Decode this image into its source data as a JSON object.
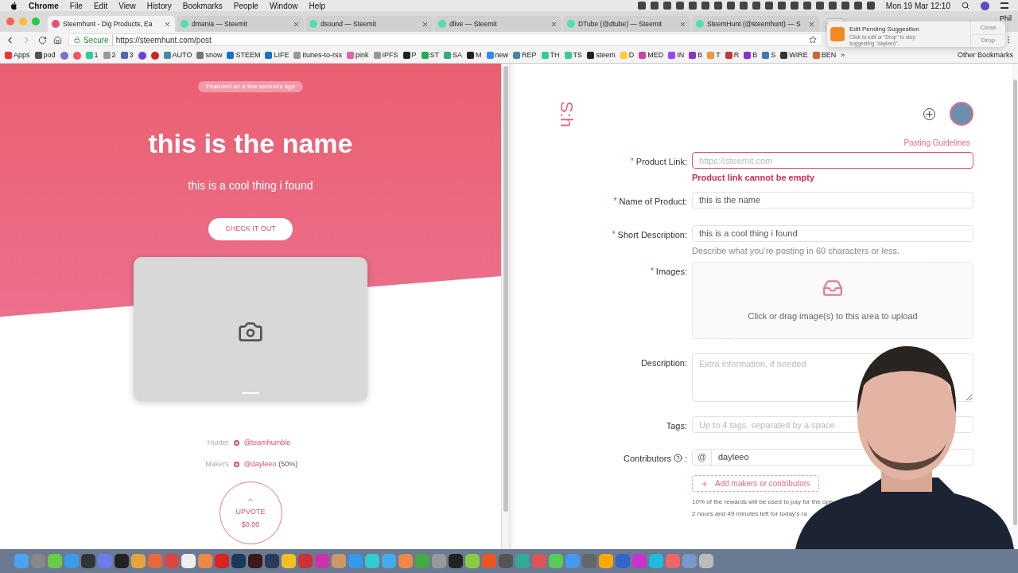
{
  "menu_bar": {
    "app": "Chrome",
    "items": [
      "File",
      "Edit",
      "View",
      "History",
      "Bookmarks",
      "People",
      "Window",
      "Help"
    ],
    "clock": "Mon 19 Mar 12:10"
  },
  "tabs": [
    {
      "title": "Steemhunt - Dig Products, Ea",
      "selected": true
    },
    {
      "title": "dmania — Steemit",
      "selected": false
    },
    {
      "title": "dsound — Steemit",
      "selected": false
    },
    {
      "title": "dlive — Steemit",
      "selected": false
    },
    {
      "title": "DTube (@dtube) — Steemit",
      "selected": false
    },
    {
      "title": "SteemHunt (@steemhunt) — S",
      "selected": false
    }
  ],
  "profile_name": "Phil",
  "address_bar": {
    "security": "Secure",
    "url": "https://steemhunt.com/post"
  },
  "bookmarks": [
    {
      "kind": "link",
      "label": "Apps"
    },
    {
      "kind": "link",
      "label": "pod"
    },
    {
      "kind": "icon"
    },
    {
      "kind": "icon"
    },
    {
      "kind": "link",
      "label": "1"
    },
    {
      "kind": "link",
      "label": "2"
    },
    {
      "kind": "link",
      "label": "3"
    },
    {
      "kind": "icon"
    },
    {
      "kind": "icon"
    },
    {
      "kind": "link",
      "label": "AUTO"
    },
    {
      "kind": "link",
      "label": "snow"
    },
    {
      "kind": "link",
      "label": "STEEM"
    },
    {
      "kind": "link",
      "label": "LIFE"
    },
    {
      "kind": "link",
      "label": "itunes-to-rss"
    },
    {
      "kind": "link",
      "label": "pink"
    },
    {
      "kind": "link",
      "label": "IPFS"
    },
    {
      "kind": "link",
      "label": "P"
    },
    {
      "kind": "link",
      "label": "ST"
    },
    {
      "kind": "link",
      "label": "SA"
    },
    {
      "kind": "link",
      "label": "M"
    },
    {
      "kind": "link",
      "label": "new"
    },
    {
      "kind": "link",
      "label": "REP"
    },
    {
      "kind": "link",
      "label": "TH"
    },
    {
      "kind": "link",
      "label": "TS"
    },
    {
      "kind": "link",
      "label": "steem"
    },
    {
      "kind": "link",
      "label": "D"
    },
    {
      "kind": "link",
      "label": "MED"
    },
    {
      "kind": "link",
      "label": "IN"
    },
    {
      "kind": "link",
      "label": "B"
    },
    {
      "kind": "link",
      "label": "T"
    },
    {
      "kind": "link",
      "label": "R"
    },
    {
      "kind": "link",
      "label": "B"
    },
    {
      "kind": "link",
      "label": "S"
    },
    {
      "kind": "link",
      "label": "WIRE"
    },
    {
      "kind": "link",
      "label": "BEN"
    }
  ],
  "bookmarks_more": "»",
  "other_bookmarks": "Other Bookmarks",
  "notification": {
    "title": "Edit Pending Suggestion",
    "body": "Click to edit or \"Drop\" to stop suggesting \"dayleeo\".",
    "buttons": [
      "Close",
      "Drop"
    ]
  },
  "preview": {
    "badge": "Featured on a few seconds ago",
    "title": "this is the name",
    "tagline": "this is a cool thing i found",
    "cta": "CHECK IT OUT",
    "credits": [
      {
        "role": "Hunter",
        "user": "@teamhumble"
      },
      {
        "role": "Makers",
        "user": "@dayleeo",
        "share": "(50%)"
      }
    ],
    "upvote": {
      "label": "UPVOTE",
      "amount": "$0.00"
    }
  },
  "form": {
    "logo": "S:h",
    "guidelines_link": "Posting Guidelines",
    "fields": [
      {
        "kind": "input",
        "label": "Product Link:",
        "required_mark": "*",
        "placeholder": "https://steemit.com",
        "error": "Product link cannot be empty"
      },
      {
        "kind": "input",
        "label": "Name of Product:",
        "required_mark": "*",
        "value": "this is the name"
      },
      {
        "kind": "input",
        "label": "Short Description:",
        "required_mark": "*",
        "value": "this is a cool thing i found",
        "hint": "Describe what you’re posting in 60 characters or less."
      },
      {
        "kind": "upload",
        "label": "Images:",
        "required_mark": "*",
        "text": "Click or drag image(s) to this area to upload"
      },
      {
        "kind": "textarea",
        "label": "Description:",
        "placeholder": "Extra information, if needed"
      },
      {
        "kind": "input",
        "label": "Tags:",
        "placeholder": "Up to 4 tags, separated by a space"
      },
      {
        "kind": "contributor",
        "label": "Contributors",
        "help": true,
        "label_end": ":",
        "prefix": "@",
        "value": "dayleeo"
      }
    ],
    "add_button": "Add makers or contributors",
    "notes": [
      "10% of the rewards will be used to pay for the ope",
      "2 hours and 49 minutes left for today's ra"
    ]
  }
}
